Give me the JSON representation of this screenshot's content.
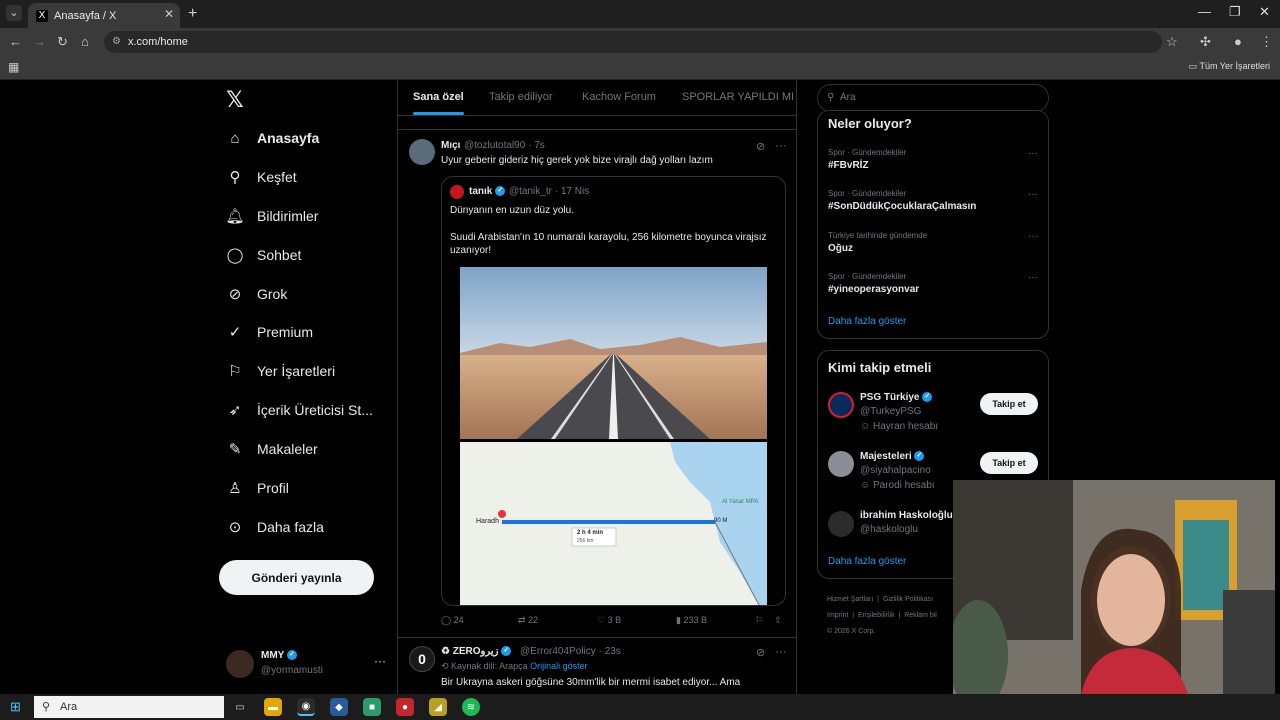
{
  "browser": {
    "tab_title": "Anasayfa / X",
    "url": "x.com/home",
    "bookmarks_all": "Tüm Yer İşaretleri"
  },
  "nav": {
    "items": [
      {
        "label": "Anasayfa",
        "icon": "home-icon"
      },
      {
        "label": "Keşfet",
        "icon": "search-icon"
      },
      {
        "label": "Bildirimler",
        "icon": "bell-icon"
      },
      {
        "label": "Sohbet",
        "icon": "chat-icon"
      },
      {
        "label": "Grok",
        "icon": "grok-icon"
      },
      {
        "label": "Premium",
        "icon": "premium-icon"
      },
      {
        "label": "Yer İşaretleri",
        "icon": "bookmark-icon"
      },
      {
        "label": "İçerik Üreticisi St...",
        "icon": "rocket-icon"
      },
      {
        "label": "Makaleler",
        "icon": "article-icon"
      },
      {
        "label": "Profil",
        "icon": "person-icon"
      },
      {
        "label": "Daha fazla",
        "icon": "more-circle-icon"
      }
    ],
    "post_button": "Gönderi yayınla",
    "account": {
      "name": "MMY",
      "handle": "@yormamusti"
    }
  },
  "feed": {
    "tabs": [
      "Sana özel",
      "Takip ediliyor",
      "Kachow Forum",
      "SPORLAR YAPILDI MI"
    ],
    "tweet1": {
      "name": "Mıçı",
      "handle": "@tozlutotal90",
      "time": "· 7s",
      "text": "Uyur geberir gideriz hiç gerek yok bize virajlı dağ yolları lazım",
      "quote": {
        "name": "tanık",
        "handle": "@tanik_tr",
        "time": "· 17 Nis",
        "text1": "Dünyanın en uzun düz yolu.",
        "text2": "Suudi Arabistan'ın 10 numaralı karayolu, 256 kilometre boyunca virajsız uzanıyor!",
        "map": {
          "route_time": "2 h 4 min",
          "route_km": "256 km",
          "start": "Haradh",
          "end": "90 M",
          "place1": "Al Yasar MPA"
        }
      },
      "stats": {
        "replies": "24",
        "reposts": "22",
        "likes": "3 B",
        "views": "233 B"
      }
    },
    "tweet2": {
      "name": "ZEROزيرو",
      "handle": "@Error404Policy",
      "time": "· 23s",
      "source_lang": "Kaynak dili: Arapça",
      "show_original": "Orijinali göster",
      "text": "Bir Ukrayna askeri göğsüne 30mm'lik bir mermi isabet ediyor... Ama"
    }
  },
  "right": {
    "search_placeholder": "Ara",
    "trends_title": "Neler oluyor?",
    "trends": [
      {
        "category": "Spor · Gündemdekiler",
        "name": "#FBvRİZ"
      },
      {
        "category": "Spor · Gündemdekiler",
        "name": "#SonDüdükÇocuklaraÇalmasın"
      },
      {
        "category": "Türkiye tarihinde gündemde",
        "name": "Oğuz"
      },
      {
        "category": "Spor · Gündemdekiler",
        "name": "#yineoperasyonvar"
      }
    ],
    "trends_more": "Daha fazla göster",
    "who_title": "Kimi takip etmeli",
    "who": [
      {
        "name": "PSG Türkiye",
        "handle": "@TurkeyPSG",
        "sub": "Hayran hesabı",
        "follow": "Takip et"
      },
      {
        "name": "Majesteleri",
        "handle": "@siyahalpacino",
        "sub": "Parodi hesabı",
        "follow": "Takip et"
      },
      {
        "name": "ibrahim Haskoloğlu",
        "handle": "@haskologlu",
        "sub": "",
        "follow": ""
      }
    ],
    "who_more": "Daha fazla göster",
    "footer": [
      "Hizmet Şartları",
      "Gizlilik Politikası",
      "Imprint",
      "Erişilebilirlik",
      "Reklam bil",
      "© 2026 X Corp."
    ]
  },
  "taskbar": {
    "search": "Ara"
  },
  "colors": {
    "accent": "#1d9bf0",
    "bg": "#000000",
    "border": "#2f3336",
    "muted": "#71767b"
  }
}
